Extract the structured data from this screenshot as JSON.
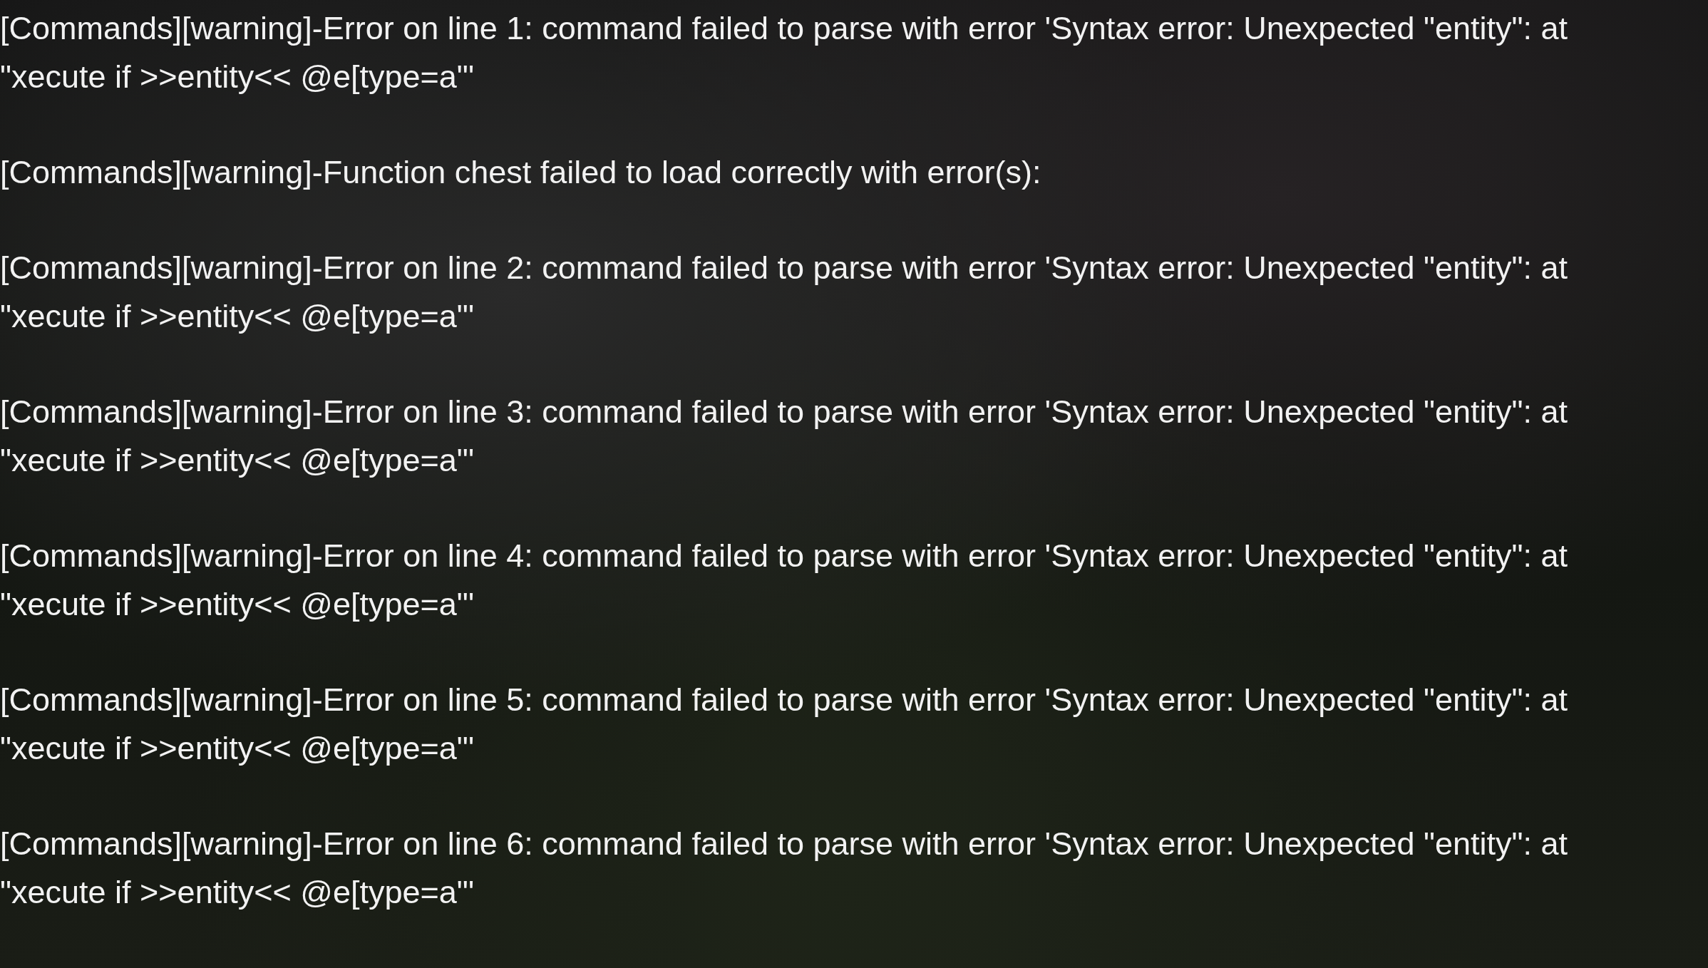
{
  "log_messages": [
    {
      "text": "[Commands][warning]-Error on line 1: command failed to parse with error 'Syntax error: Unexpected \"entity\": at \"xecute if >>entity<< @e[type=a\"'"
    },
    {
      "text": "[Commands][warning]-Function chest failed to load correctly with error(s):"
    },
    {
      "text": "[Commands][warning]-Error on line 2: command failed to parse with error 'Syntax error: Unexpected \"entity\": at \"xecute if >>entity<< @e[type=a\"'"
    },
    {
      "text": "[Commands][warning]-Error on line 3: command failed to parse with error 'Syntax error: Unexpected \"entity\": at \"xecute if >>entity<< @e[type=a\"'"
    },
    {
      "text": "[Commands][warning]-Error on line 4: command failed to parse with error 'Syntax error: Unexpected \"entity\": at \"xecute if >>entity<< @e[type=a\"'"
    },
    {
      "text": "[Commands][warning]-Error on line 5: command failed to parse with error 'Syntax error: Unexpected \"entity\": at \"xecute if >>entity<< @e[type=a\"'"
    },
    {
      "text": "[Commands][warning]-Error on line 6: command failed to parse with error 'Syntax error: Unexpected \"entity\": at \"xecute if >>entity<< @e[type=a\"'"
    }
  ]
}
